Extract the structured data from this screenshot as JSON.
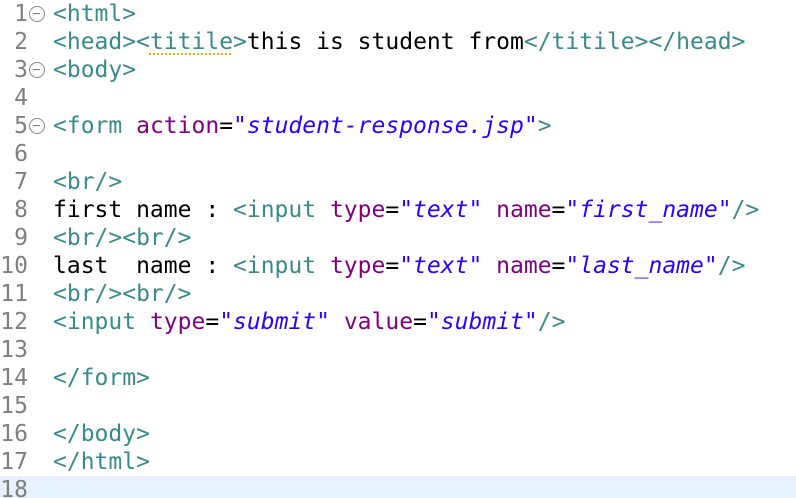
{
  "editor": {
    "colors": {
      "tag": "#3a8a8a",
      "attribute": "#7f007f",
      "string": "#2a00ff",
      "text": "#000000",
      "line_number": "#7f7f7f",
      "current_line": "#e8f2fe",
      "warning_underline": "#e6b400"
    },
    "lines": [
      {
        "number": "1",
        "fold": true,
        "tokens": [
          {
            "k": "tag",
            "t": "<html>"
          }
        ]
      },
      {
        "number": "2",
        "fold": false,
        "tokens": [
          {
            "k": "tag",
            "t": "<head>"
          },
          {
            "k": "tag",
            "t": "<"
          },
          {
            "k": "tag warn",
            "t": "titile"
          },
          {
            "k": "tag",
            "t": ">"
          },
          {
            "k": "txt",
            "t": "this is student from"
          },
          {
            "k": "tag",
            "t": "</titile></head>"
          }
        ]
      },
      {
        "number": "3",
        "fold": true,
        "tokens": [
          {
            "k": "tag",
            "t": "<body>"
          }
        ]
      },
      {
        "number": "4",
        "fold": false,
        "tokens": []
      },
      {
        "number": "5",
        "fold": true,
        "tokens": [
          {
            "k": "tag",
            "t": "<form "
          },
          {
            "k": "attr",
            "t": "action"
          },
          {
            "k": "txt",
            "t": "="
          },
          {
            "k": "val",
            "t": "\"student-response.jsp\""
          },
          {
            "k": "tag",
            "t": ">"
          }
        ]
      },
      {
        "number": "6",
        "fold": false,
        "tokens": []
      },
      {
        "number": "7",
        "fold": false,
        "tokens": [
          {
            "k": "tag",
            "t": "<br/>"
          }
        ]
      },
      {
        "number": "8",
        "fold": false,
        "tokens": [
          {
            "k": "txt",
            "t": "first name : "
          },
          {
            "k": "tag",
            "t": "<input "
          },
          {
            "k": "attr",
            "t": "type"
          },
          {
            "k": "txt",
            "t": "="
          },
          {
            "k": "val",
            "t": "\"text\""
          },
          {
            "k": "txt",
            "t": " "
          },
          {
            "k": "attr",
            "t": "name"
          },
          {
            "k": "txt",
            "t": "="
          },
          {
            "k": "val",
            "t": "\"first_name\""
          },
          {
            "k": "tag",
            "t": "/>"
          }
        ]
      },
      {
        "number": "9",
        "fold": false,
        "tokens": [
          {
            "k": "tag",
            "t": "<br/><br/>"
          }
        ]
      },
      {
        "number": "10",
        "fold": false,
        "tokens": [
          {
            "k": "txt",
            "t": "last  name : "
          },
          {
            "k": "tag",
            "t": "<input "
          },
          {
            "k": "attr",
            "t": "type"
          },
          {
            "k": "txt",
            "t": "="
          },
          {
            "k": "val",
            "t": "\"text\""
          },
          {
            "k": "txt",
            "t": " "
          },
          {
            "k": "attr",
            "t": "name"
          },
          {
            "k": "txt",
            "t": "="
          },
          {
            "k": "val",
            "t": "\"last_name\""
          },
          {
            "k": "tag",
            "t": "/>"
          }
        ]
      },
      {
        "number": "11",
        "fold": false,
        "tokens": [
          {
            "k": "tag",
            "t": "<br/><br/>"
          }
        ]
      },
      {
        "number": "12",
        "fold": false,
        "tokens": [
          {
            "k": "tag",
            "t": "<input "
          },
          {
            "k": "attr",
            "t": "type"
          },
          {
            "k": "txt",
            "t": "="
          },
          {
            "k": "val",
            "t": "\"submit\""
          },
          {
            "k": "txt",
            "t": " "
          },
          {
            "k": "attr",
            "t": "value"
          },
          {
            "k": "txt",
            "t": "="
          },
          {
            "k": "val",
            "t": "\"submit\""
          },
          {
            "k": "tag",
            "t": "/>"
          }
        ]
      },
      {
        "number": "13",
        "fold": false,
        "tokens": []
      },
      {
        "number": "14",
        "fold": false,
        "tokens": [
          {
            "k": "tag",
            "t": "</form>"
          }
        ]
      },
      {
        "number": "15",
        "fold": false,
        "tokens": []
      },
      {
        "number": "16",
        "fold": false,
        "tokens": [
          {
            "k": "tag",
            "t": "</body>"
          }
        ]
      },
      {
        "number": "17",
        "fold": false,
        "tokens": [
          {
            "k": "tag",
            "t": "</html>"
          }
        ]
      },
      {
        "number": "18",
        "fold": false,
        "current": true,
        "tokens": []
      }
    ]
  }
}
